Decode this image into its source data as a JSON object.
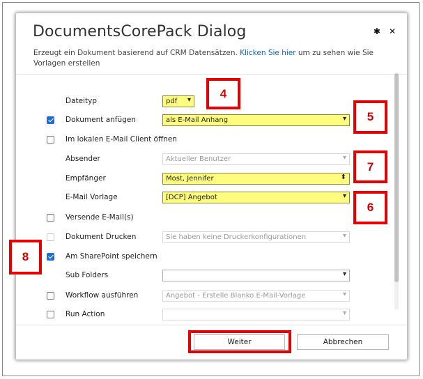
{
  "dialog": {
    "title": "DocumentsCorePack Dialog",
    "subtitle_text": "Erzeugt ein Dokument basierend auf CRM Datensätzen.",
    "subtitle_link": "Klicken Sie hier",
    "subtitle_rest": "um zu sehen wie Sie Vorlagen erstellen",
    "icons": [
      "gear-icon",
      "close-icon"
    ]
  },
  "form": {
    "dateityp": {
      "label": "Dateityp",
      "value": "pdf"
    },
    "dokument_anfuegen": {
      "label": "Dokument anfügen",
      "checked": true,
      "value": "als E-Mail Anhang"
    },
    "lokal_email": {
      "label": "Im lokalen E-Mail Client öffnen",
      "checked": false
    },
    "absender": {
      "label": "Absender",
      "value": "Aktueller Benutzer"
    },
    "empfaenger": {
      "label": "Empfänger",
      "value": "Most, Jennifer"
    },
    "email_vorlage": {
      "label": "E-Mail Vorlage",
      "value": "[DCP] Angebot"
    },
    "versende": {
      "label": "Versende E-Mail(s)",
      "checked": false
    },
    "drucken": {
      "label": "Dokument Drucken",
      "checked": false,
      "value": "Sie haben keine Druckerkonfigurationen"
    },
    "sharepoint": {
      "label": "Am SharePoint speichern",
      "checked": true
    },
    "subfolders": {
      "label": "Sub Folders",
      "value": ""
    },
    "workflow": {
      "label": "Workflow ausführen",
      "checked": false,
      "value": "Angebot - Erstelle Blanko E-Mail-Vorlage"
    },
    "run_action": {
      "label": "Run Action",
      "checked": false,
      "value": ""
    }
  },
  "buttons": {
    "weiter": "Weiter",
    "abbrechen": "Abbrechen"
  },
  "callouts": {
    "c4": "4",
    "c5": "5",
    "c6": "6",
    "c7": "7",
    "c8": "8"
  },
  "colors": {
    "highlight": "#fffd80",
    "callout_red": "#e60000",
    "checkbox_blue": "#1f6fd1",
    "link_blue": "#0a64b8"
  }
}
